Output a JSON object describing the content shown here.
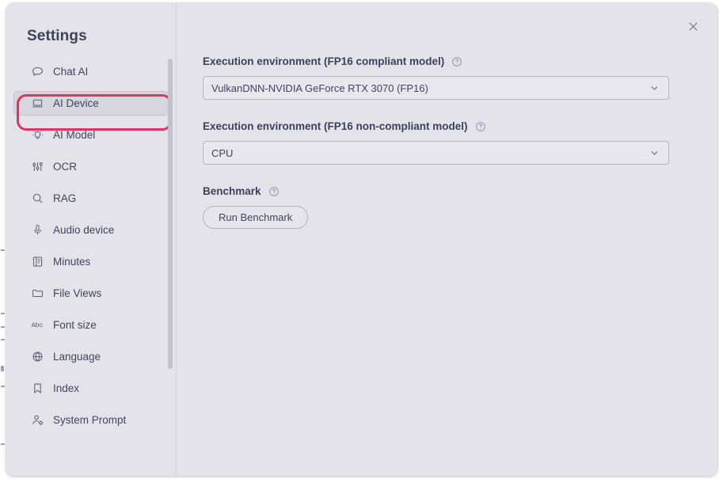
{
  "window": {
    "title": "Settings",
    "close_icon": "close-icon",
    "accent_highlight_color": "#e23262",
    "background_color": "#e4e3e9",
    "selected_item_color": "#d7d6dc"
  },
  "sidebar": {
    "items": [
      {
        "label": "Chat AI",
        "icon": "chat-bubble-icon",
        "selected": false
      },
      {
        "label": "AI Device",
        "icon": "laptop-icon",
        "selected": true
      },
      {
        "label": "AI Model",
        "icon": "lightbulb-icon",
        "selected": false
      },
      {
        "label": "OCR",
        "icon": "sliders-icon",
        "selected": false
      },
      {
        "label": "RAG",
        "icon": "search-icon",
        "selected": false
      },
      {
        "label": "Audio device",
        "icon": "microphone-icon",
        "selected": false
      },
      {
        "label": "Minutes",
        "icon": "book-icon",
        "selected": false
      },
      {
        "label": "File Views",
        "icon": "folder-icon",
        "selected": false
      },
      {
        "label": "Font size",
        "icon": "abc-text-icon",
        "selected": false
      },
      {
        "label": "Language",
        "icon": "globe-icon",
        "selected": false
      },
      {
        "label": "Index",
        "icon": "bookmark-icon",
        "selected": false
      },
      {
        "label": "System Prompt",
        "icon": "user-gear-icon",
        "selected": false
      }
    ]
  },
  "main": {
    "fp16_compliant": {
      "label": "Execution environment (FP16 compliant model)",
      "help_icon": "help-circle-icon",
      "value": "VulkanDNN-NVIDIA GeForce RTX 3070 (FP16)",
      "chevron_icon": "chevron-down-icon"
    },
    "fp16_non_compliant": {
      "label": "Execution environment (FP16 non-compliant model)",
      "help_icon": "help-circle-icon",
      "value": "CPU",
      "chevron_icon": "chevron-down-icon"
    },
    "benchmark": {
      "label": "Benchmark",
      "help_icon": "help-circle-icon",
      "button_label": "Run Benchmark"
    }
  }
}
